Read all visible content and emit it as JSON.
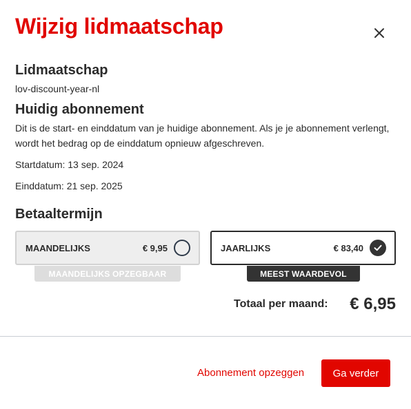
{
  "dialog": {
    "title": "Wijzig lidmaatschap",
    "close_icon": "close-icon"
  },
  "membership": {
    "heading": "Lidmaatschap",
    "code": "lov-discount-year-nl"
  },
  "current_subscription": {
    "heading": "Huidig abonnement",
    "description": "Dit is de start- en einddatum van je huidige abonnement. Als je je abonnement verlengt, wordt het bedrag op de einddatum opnieuw afgeschreven.",
    "start_date": "Startdatum: 13 sep. 2024",
    "end_date": "Einddatum: 21 sep. 2025"
  },
  "payment_term": {
    "heading": "Betaaltermijn",
    "options": [
      {
        "label": "MAANDELIJKS",
        "price": "€ 9,95",
        "selected": false,
        "badge": "MAANDELIJKS OPZEGBAAR"
      },
      {
        "label": "JAARLIJKS",
        "price": "€ 83,40",
        "selected": true,
        "badge": "MEEST WAARDEVOL"
      }
    ]
  },
  "total": {
    "label": "Totaal per maand:",
    "value": "€ 6,95"
  },
  "footer": {
    "cancel_label": "Abonnement opzeggen",
    "continue_label": "Ga verder"
  },
  "colors": {
    "brand_red": "#e10600",
    "dark": "#333333",
    "disabled_badge": "#dddddd",
    "unselected_option_bg": "#eeeeee"
  }
}
